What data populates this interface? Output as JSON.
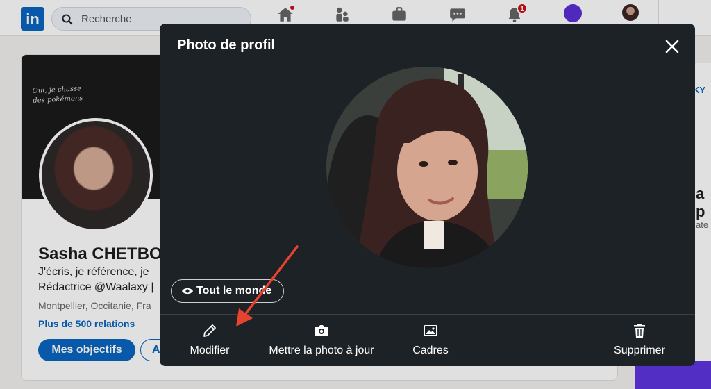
{
  "topnav": {
    "logo_text": "in",
    "search_placeholder": "Recherche",
    "icons": [
      "home-icon",
      "network-icon",
      "jobs-icon",
      "messaging-icon",
      "notifications-icon",
      "premium-icon",
      "avatar"
    ],
    "notifications_badge": "1"
  },
  "profile": {
    "cover_text_line1": "Oui, je chasse",
    "cover_text_line2": "des pokémons",
    "name": "Sasha CHETBO",
    "headline_line1": "J'écris, je référence, je",
    "headline_line2": "Rédactrice @Waalaxy |",
    "location": "Montpellier, Occitanie, Fra",
    "relations": "Plus de 500 relations",
    "button_primary": "Mes objectifs",
    "button_secondary": "A"
  },
  "right_column": {
    "text1": "KY",
    "text2": "a p",
    "text3": "ate"
  },
  "modal": {
    "title": "Photo de profil",
    "visibility_label": "Tout le monde",
    "actions": [
      {
        "label": "Modifier",
        "icon": "pencil-icon"
      },
      {
        "label": "Mettre la photo à jour",
        "icon": "camera-icon"
      },
      {
        "label": "Cadres",
        "icon": "frame-icon"
      },
      {
        "label": "Supprimer",
        "icon": "trash-icon"
      }
    ]
  },
  "colors": {
    "brand": "#0a66c2",
    "modal_bg": "#1d2226",
    "annotation_arrow": "#e8432e",
    "badge": "#cc1016"
  }
}
